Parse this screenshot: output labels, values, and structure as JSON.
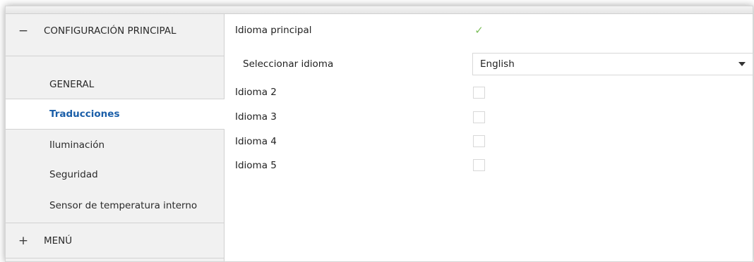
{
  "sidebar": {
    "section_main": {
      "sign": "−",
      "label": "CONFIGURACIÓN PRINCIPAL"
    },
    "items": [
      {
        "label": "GENERAL"
      },
      {
        "label": "Traducciones"
      },
      {
        "label": "Iluminación"
      },
      {
        "label": "Seguridad"
      },
      {
        "label": "Sensor de temperatura interno"
      }
    ],
    "section_menu": {
      "sign": "+",
      "label": "MENÚ"
    }
  },
  "main": {
    "idioma_principal": {
      "label": "Idioma principal",
      "checked": true,
      "tick": "✓"
    },
    "seleccionar_idioma": {
      "label": "Seleccionar idioma",
      "value": "English"
    },
    "idioma_2": {
      "label": "Idioma 2",
      "checked": false
    },
    "idioma_3": {
      "label": "Idioma 3",
      "checked": false
    },
    "idioma_4": {
      "label": "Idioma 4",
      "checked": false
    },
    "idioma_5": {
      "label": "Idioma 5",
      "checked": false
    }
  },
  "colors": {
    "active_link": "#1a5ea8",
    "sidebar_bg": "#f1f1f1",
    "checkmark": "#7cbf5a"
  }
}
